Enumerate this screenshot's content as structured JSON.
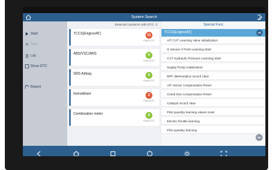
{
  "statusbar": {
    "left": " ",
    "center": " ",
    "right": " "
  },
  "title": "System Search",
  "sidebar": {
    "items": [
      {
        "label": "Start"
      },
      {
        "label": "Stop"
      },
      {
        "label": "List"
      },
      {
        "label": "Show DTC"
      },
      {
        "label": "Report"
      }
    ]
  },
  "middle": {
    "detected": "Detected Systems with DTC: 3",
    "systems": [
      {
        "name": "TCCS(Engine/AT)",
        "count": "11",
        "dtc_label": "Fault DTC",
        "color": "#e05a3a"
      },
      {
        "name": "ABS/VSC/ARS",
        "count": "0",
        "dtc_label": "Fault DTC",
        "color": "#8cc63f"
      },
      {
        "name": "SRS Airbag",
        "count": "0",
        "dtc_label": "Fault DTC",
        "color": "#8cc63f"
      },
      {
        "name": "Immobiliser",
        "count": "2",
        "dtc_label": "Fault DTC",
        "color": "#e05a3a"
      },
      {
        "name": "Combination meter",
        "count": "0",
        "dtc_label": "Fault DTC",
        "color": "#8cc63f"
      }
    ]
  },
  "right": {
    "header": "Special Func",
    "group": "TCCS(Engine/AT)",
    "functions": [
      "A/T CVT Learning Value Initialization",
      "G Sensor 0 Point Learning Start",
      "CVT Hydraulic Pressure Learning Start",
      "Supply Pump Initialization",
      "DPF deterioration record clear",
      "A/F sensor compensation Reset",
      "Crank time compensation Reset",
      "Catalyst record clear",
      "Pilot quantity learning values reset",
      "Electric throttle learning",
      "Pilot quantity learning"
    ]
  },
  "colors": {
    "titlebar": "#2c5f8e",
    "group_header": "#5ba7d8",
    "fault": "#e05a3a",
    "ok": "#8cc63f"
  }
}
